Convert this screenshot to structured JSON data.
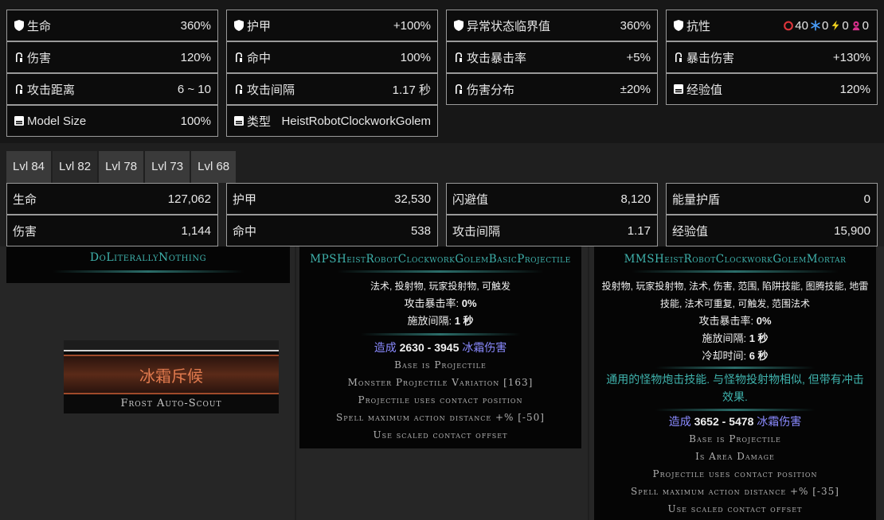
{
  "base_stats": [
    {
      "id": "life",
      "icon": "shield-icon",
      "label": "生命",
      "value": "360%"
    },
    {
      "id": "armour",
      "icon": "shield-icon",
      "label": "护甲",
      "value": "+100%"
    },
    {
      "id": "ailment",
      "icon": "shield-icon",
      "label": "异常状态临界值",
      "value": "360%"
    },
    {
      "id": "res",
      "icon": "shield-icon",
      "label": "抗性"
    },
    {
      "id": "damage",
      "icon": "fist-icon",
      "label": "伤害",
      "value": "120%"
    },
    {
      "id": "accuracy",
      "icon": "fist-icon",
      "label": "命中",
      "value": "100%"
    },
    {
      "id": "crit",
      "icon": "fist-icon",
      "label": "攻击暴击率",
      "value": "+5%"
    },
    {
      "id": "critdmg",
      "icon": "fist-icon",
      "label": "暴击伤害",
      "value": "+130%"
    },
    {
      "id": "range",
      "icon": "fist-icon",
      "label": "攻击距离",
      "value": "6 ~ 10"
    },
    {
      "id": "interval",
      "icon": "fist-icon",
      "label": "攻击间隔",
      "value": "1.17 秒"
    },
    {
      "id": "spread",
      "icon": "fist-icon",
      "label": "伤害分布",
      "value": "±20%"
    },
    {
      "id": "exp",
      "icon": "book-icon",
      "label": "经验值",
      "value": "120%"
    },
    {
      "id": "model",
      "icon": "book-icon",
      "label": "Model Size",
      "value": "100%"
    },
    {
      "id": "type",
      "icon": "book-icon",
      "label": "类型",
      "value": "HeistRobotClockworkGolem"
    }
  ],
  "resistances": [
    {
      "icon": "fire-icon",
      "value": "40",
      "color": "#e0353b"
    },
    {
      "icon": "snowflake-icon",
      "value": "0",
      "color": "#4aa0ff"
    },
    {
      "icon": "lightning-icon",
      "value": "0",
      "color": "#f2d21e"
    },
    {
      "icon": "chaos-icon",
      "value": "0",
      "color": "#d8308c"
    }
  ],
  "level_tabs": [
    "Lvl 84",
    "Lvl 82",
    "Lvl 78",
    "Lvl 73",
    "Lvl 68"
  ],
  "level_stats": [
    {
      "label": "生命",
      "value": "127,062"
    },
    {
      "label": "护甲",
      "value": "32,530"
    },
    {
      "label": "闪避值",
      "value": "8,120"
    },
    {
      "label": "能量护盾",
      "value": "0"
    },
    {
      "label": "伤害",
      "value": "1,144"
    },
    {
      "label": "命中",
      "value": "538"
    },
    {
      "label": "攻击间隔",
      "value": "1.17"
    },
    {
      "label": "经验值",
      "value": "15,900"
    }
  ],
  "skill1": {
    "name": "DoLiterallyNothing"
  },
  "item": {
    "header_text": "",
    "name_cn": "冰霜斥候",
    "name_en": "Frost Auto-Scout"
  },
  "skill2": {
    "name": "MPSHeistRobotClockworkGolemBasicProjectile",
    "tags": "法术, 投射物, 玩家投射物, 可触发",
    "crit_label": "攻击暴击率:",
    "crit_value": "0%",
    "cast_label": "施放间隔:",
    "cast_value": "1 秒",
    "dmg_word": "造成",
    "dmg_min": "2630",
    "dmg_sep": " - ",
    "dmg_max": "3945",
    "dmg_type": "冰霜伤害",
    "mods": [
      "Base is Projectile",
      "Monster Projectile Variation [163]",
      "Projectile uses contact position",
      "Spell maximum action distance +% [-50]",
      "Use scaled contact offset"
    ]
  },
  "skill3": {
    "name": "MMSHeistRobotClockworkGolemMortar",
    "tags1": "投射物, 玩家投射物, 法术, 伤害, 范围, 陷阱技能, 图腾技能, 地雷",
    "tags2": "技能, 法术可重复, 可触发, 范围法术",
    "crit_label": "攻击暴击率:",
    "crit_value": "0%",
    "cast_label": "施放间隔:",
    "cast_value": "1 秒",
    "cd_label": "冷却时间:",
    "cd_value": "6 秒",
    "desc1": "通用的怪物炮击技能. 与怪物投射物相似, 但带有冲击",
    "desc2": "效果.",
    "dmg_word": "造成",
    "dmg_min": "3652",
    "dmg_sep": " - ",
    "dmg_max": "5478",
    "dmg_type": "冰霜伤害",
    "mods": [
      "Base is Projectile",
      "Is Area Damage",
      "Projectile uses contact position",
      "Spell maximum action distance +% [-35]",
      "Use scaled contact offset"
    ]
  }
}
